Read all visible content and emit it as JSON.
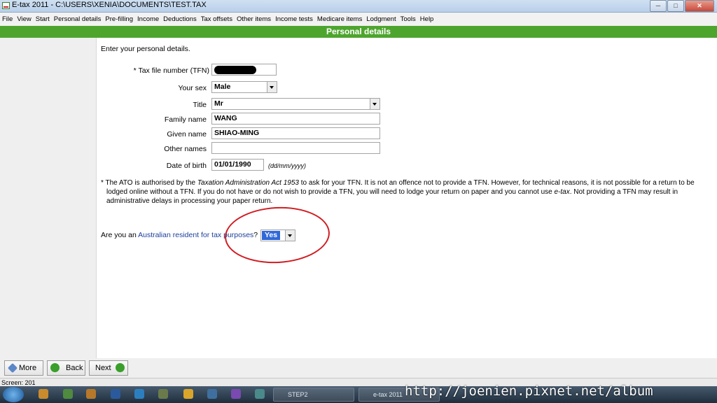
{
  "window": {
    "title": "E-tax 2011 - C:\\USERS\\XENIA\\DOCUMENTS\\TEST.TAX",
    "minimize": "─",
    "maximize": "□",
    "close": "✕"
  },
  "menu": [
    "File",
    "View",
    "Start",
    "Personal details",
    "Pre-filling",
    "Income",
    "Deductions",
    "Tax offsets",
    "Other items",
    "Income tests",
    "Medicare items",
    "Lodgment",
    "Tools",
    "Help"
  ],
  "section_title": "Personal details",
  "form": {
    "intro": "Enter your personal details.",
    "tfn_label": "* Tax file number (TFN)",
    "sex_label": "Your sex",
    "sex_value": "Male",
    "title_label": "Title",
    "title_value": "Mr",
    "family_label": "Family name",
    "family_value": "WANG",
    "given_label": "Given name",
    "given_value": "SHIAO-MING",
    "other_label": "Other names",
    "other_value": "",
    "dob_label": "Date of birth",
    "dob_value": "01/01/1990",
    "dob_hint": "(dd/mm/yyyy)"
  },
  "note": {
    "p1": "* The ATO is authorised by the ",
    "act": "Taxation Administration Act 1953",
    "p2": " to ask for your TFN. It is not an offence not to provide a TFN. However, for technical reasons, it is not possible for a return to be lodged online without a TFN. If you do not have or do not wish to provide a TFN, you will need to lodge your return on paper and you cannot use ",
    "etax": "e-tax",
    "p3": ". Not providing a TFN may result in administrative delays in processing your paper return."
  },
  "question": {
    "prefix": "Are you an ",
    "link": "Australian resident for tax purposes",
    "suffix": "?",
    "answer": "Yes"
  },
  "nav": {
    "more": "More",
    "back": "Back",
    "next": "Next"
  },
  "status": "Screen: 201",
  "taskbar": {
    "task1": "STEP2",
    "task2": "e-tax 2011"
  },
  "watermark": "http://joenien.pixnet.net/album",
  "colors": {
    "header_green": "#4ea52e",
    "link_blue": "#1a3f9a",
    "annotation_red": "#d11d22",
    "selection_blue": "#3068d8"
  }
}
